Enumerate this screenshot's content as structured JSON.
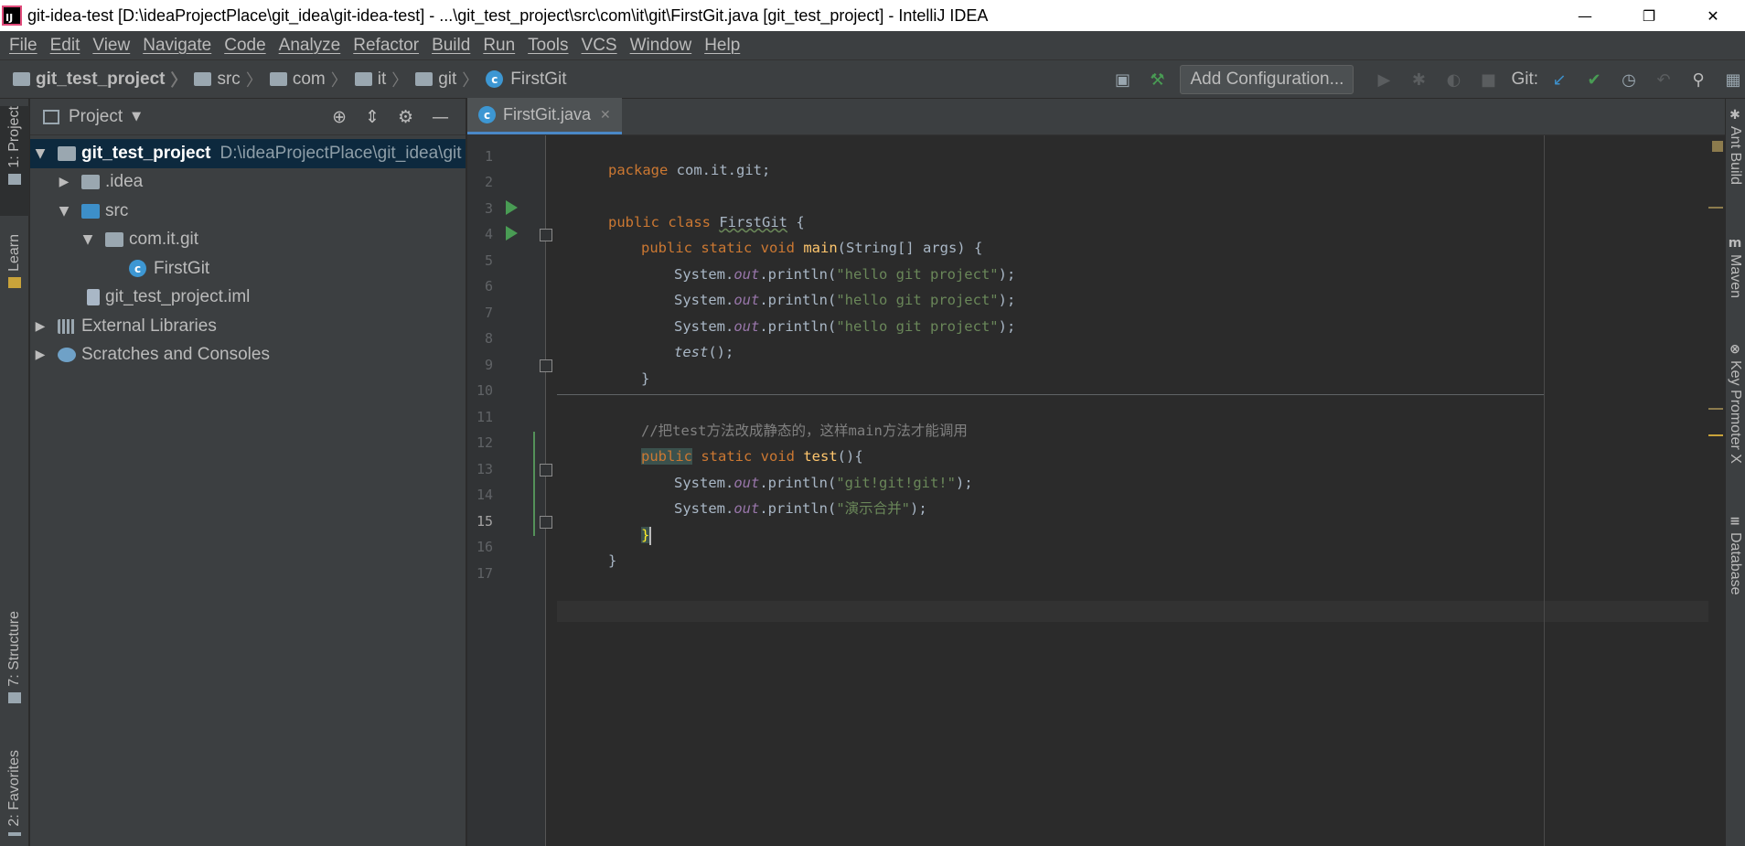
{
  "window": {
    "title": "git-idea-test [D:\\ideaProjectPlace\\git_idea\\git-idea-test] - ...\\git_test_project\\src\\com\\it\\git\\FirstGit.java [git_test_project] - IntelliJ IDEA",
    "logo_text": "IJ",
    "minimize": "—",
    "restore": "❐",
    "close": "✕"
  },
  "menu": [
    "File",
    "Edit",
    "View",
    "Navigate",
    "Code",
    "Analyze",
    "Refactor",
    "Build",
    "Run",
    "Tools",
    "VCS",
    "Window",
    "Help"
  ],
  "breadcrumbs": [
    {
      "label": "git_test_project",
      "icon": "module-icon"
    },
    {
      "label": "src",
      "icon": "folder-icon"
    },
    {
      "label": "com",
      "icon": "folder-icon"
    },
    {
      "label": "it",
      "icon": "folder-icon"
    },
    {
      "label": "git",
      "icon": "folder-icon"
    },
    {
      "label": "FirstGit",
      "icon": "java-class-icon"
    }
  ],
  "toolbar": {
    "add_configuration": "Add Configuration...",
    "git_label": "Git:"
  },
  "left_strip": {
    "project": "1: Project",
    "learn": "Learn",
    "structure": "7: Structure",
    "favorites": "2: Favorites"
  },
  "right_strip": {
    "ant": "Ant Build",
    "maven": "Maven",
    "key_promoter": "Key Promoter X",
    "database": "Database"
  },
  "project_panel": {
    "title": "Project",
    "tree": [
      {
        "label": "git_test_project",
        "path": "D:\\ideaProjectPlace\\git_idea\\git",
        "depth": 0,
        "arrow": "▼",
        "icon": "module",
        "selected": true
      },
      {
        "label": ".idea",
        "depth": 1,
        "arrow": "▶",
        "icon": "folder"
      },
      {
        "label": "src",
        "depth": 1,
        "arrow": "▼",
        "icon": "src"
      },
      {
        "label": "com.it.git",
        "depth": 2,
        "arrow": "▼",
        "icon": "pkg"
      },
      {
        "label": "FirstGit",
        "depth": 3,
        "arrow": "",
        "icon": "java"
      },
      {
        "label": "git_test_project.iml",
        "depth": 1,
        "arrow": "",
        "icon": "iml"
      },
      {
        "label": "External Libraries",
        "depth": 0,
        "arrow": "▶",
        "icon": "lib"
      },
      {
        "label": "Scratches and Consoles",
        "depth": 0,
        "arrow": "▶",
        "icon": "scratch"
      }
    ]
  },
  "editor": {
    "tab": "FirstGit.java",
    "line_numbers": [
      "1",
      "2",
      "3",
      "4",
      "5",
      "6",
      "7",
      "8",
      "9",
      "10",
      "11",
      "12",
      "13",
      "14",
      "15",
      "16",
      "17"
    ],
    "code": {
      "l1_kw": "package",
      "l1_rest": " com.it.git;",
      "l3_kw": "public class",
      "l3_cls": "FirstGit",
      "l3_rest": " {",
      "l4_kw": "public static void",
      "l4_fn": "main",
      "l4_rest": "(String[] args) {",
      "sys": "System.",
      "out": "out",
      "println": ".println(",
      "hello": "\"hello git project\"",
      "end": ");",
      "l8_test": "test",
      "l8_rest": "();",
      "l9": "}",
      "l11_cmt": "//把test方法改成静态的，这样main方法才能调用",
      "l12_kw1": "public",
      "l12_kw2": " static void",
      "l12_fn": "test",
      "l12_rest": "(){",
      "l13_str": "\"git!git!git!\"",
      "l14_str": "\"演示合并\"",
      "l15": "}",
      "l16": "}"
    }
  }
}
